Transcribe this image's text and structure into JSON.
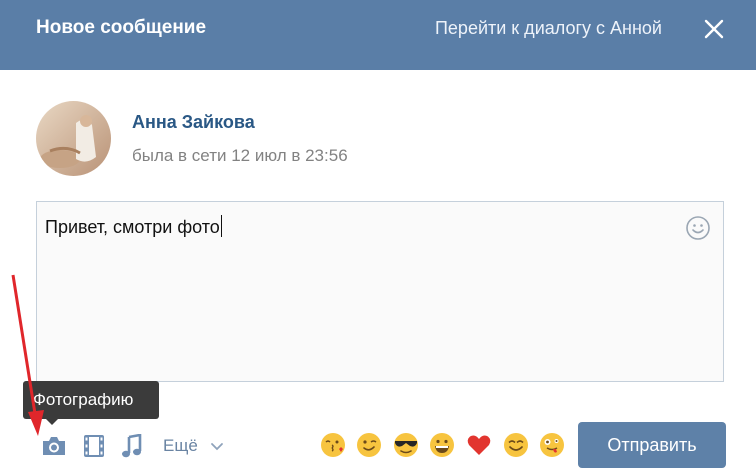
{
  "header": {
    "title": "Новое сообщение",
    "go_to_dialog": "Перейти к диалогу с Анной",
    "close_icon": "close-icon"
  },
  "contact": {
    "name": "Анна Зайкова",
    "status": "была в сети 12 июл в 23:56"
  },
  "composer": {
    "text": "Привет, смотри фото",
    "emoji_picker_icon": "smiley-icon"
  },
  "tooltip": {
    "text": "Фотографию"
  },
  "toolbar": {
    "photo_icon": "camera-icon",
    "video_icon": "film-icon",
    "audio_icon": "music-note-icon",
    "more_label": "Ещё",
    "more_icon": "chevron-down-icon",
    "send_label": "Отправить"
  },
  "emojis": [
    "kissing-face",
    "winking-face",
    "sunglasses-face",
    "grinning-face",
    "heart",
    "smiling-face",
    "crazy-face"
  ],
  "colors": {
    "header_bg": "#5a7ea7",
    "link": "#2a5885",
    "button": "#5e81a8",
    "arrow": "#e0262b"
  }
}
